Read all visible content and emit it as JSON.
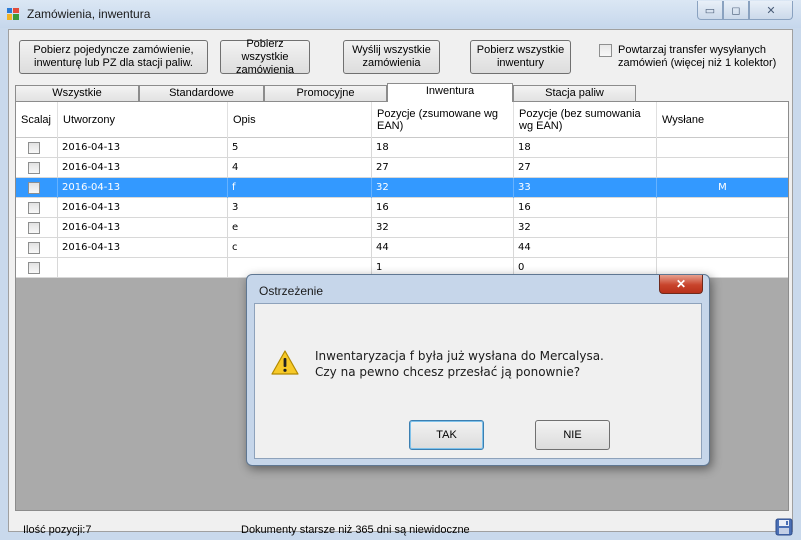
{
  "window": {
    "title": "Zamówienia, inwentura"
  },
  "toolbar": {
    "btn1": "Pobierz pojedyncze zamówienie, inwenturę lub PZ dla stacji paliw.",
    "btn2": "Pobierz wszystkie zamówienia",
    "btn3": "Wyślij wszystkie zamówienia",
    "btn4": "Pobierz wszystkie inwentury",
    "repeat_label": "Powtarzaj transfer wysyłanych zamówień (więcej niż 1 kolektor)"
  },
  "tabs": [
    "Wszystkie",
    "Standardowe",
    "Promocyjne",
    "Inwentura",
    "Stacja paliw"
  ],
  "grid": {
    "columns": [
      "Scalaj",
      "Utworzony",
      "Opis",
      "Pozycje (zsumowane wg EAN)",
      "Pozycje (bez sumowania wg EAN)",
      "Wysłane"
    ],
    "rows": [
      {
        "created": "2016-04-13",
        "desc": "5",
        "pos_sum": "18",
        "pos_nosum": "18",
        "sent": ""
      },
      {
        "created": "2016-04-13",
        "desc": "4",
        "pos_sum": "27",
        "pos_nosum": "27",
        "sent": ""
      },
      {
        "created": "2016-04-13",
        "desc": "f",
        "pos_sum": "32",
        "pos_nosum": "33",
        "sent": "M"
      },
      {
        "created": "2016-04-13",
        "desc": "3",
        "pos_sum": "16",
        "pos_nosum": "16",
        "sent": ""
      },
      {
        "created": "2016-04-13",
        "desc": "e",
        "pos_sum": "32",
        "pos_nosum": "32",
        "sent": ""
      },
      {
        "created": "2016-04-13",
        "desc": "c",
        "pos_sum": "44",
        "pos_nosum": "44",
        "sent": ""
      },
      {
        "created": "",
        "desc": "",
        "pos_sum": "1",
        "pos_nosum": "0",
        "sent": ""
      }
    ]
  },
  "status": {
    "count": "Ilość pozycji:7",
    "info": "Dokumenty starsze niż 365 dni są niewidoczne"
  },
  "dialog": {
    "title": "Ostrzeżenie",
    "line1": "Inwentaryzacja f była już wysłana do Mercalysa.",
    "line2": "Czy na pewno chcesz przesłać ją ponownie?",
    "yes": "TAK",
    "no": "NIE"
  },
  "colors": {
    "selection": "#3399ff",
    "titlebar": "#c6d7ec"
  }
}
